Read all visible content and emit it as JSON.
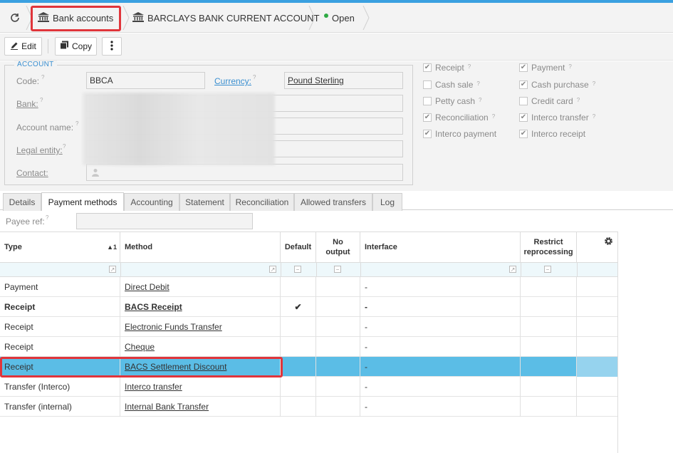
{
  "breadcrumb": {
    "bank_accounts": "Bank accounts",
    "account_name": "BARCLAYS BANK CURRENT ACCOUNT",
    "status": "Open",
    "status_color": "#2eaa44"
  },
  "toolbar": {
    "edit": "Edit",
    "copy": "Copy"
  },
  "account": {
    "legend": "ACCOUNT",
    "code_label": "Code:",
    "code_value": "BBCA",
    "currency_label": "Currency:",
    "currency_value": "Pound Sterling",
    "bank_label": "Bank:",
    "account_name_label": "Account name:",
    "legal_entity_label": "Legal entity:",
    "contact_label": "Contact:"
  },
  "flags": [
    {
      "label": "Receipt",
      "checked": true
    },
    {
      "label": "Payment",
      "checked": true
    },
    {
      "label": "Cash sale",
      "checked": false
    },
    {
      "label": "Cash purchase",
      "checked": true
    },
    {
      "label": "Petty cash",
      "checked": false
    },
    {
      "label": "Credit card",
      "checked": false
    },
    {
      "label": "Reconciliation",
      "checked": true
    },
    {
      "label": "Interco transfer",
      "checked": true
    },
    {
      "label": "Interco payment",
      "checked": true
    },
    {
      "label": "Interco receipt",
      "checked": true
    }
  ],
  "tabs": [
    "Details",
    "Payment methods",
    "Accounting",
    "Statement",
    "Reconciliation",
    "Allowed transfers",
    "Log"
  ],
  "active_tab": "Payment methods",
  "payee_ref_label": "Payee ref:",
  "grid": {
    "columns": {
      "type": "Type",
      "sort": "▲1",
      "method": "Method",
      "default": "Default",
      "no_output_1": "No",
      "no_output_2": "output",
      "interface": "Interface",
      "restrict_1": "Restrict",
      "restrict_2": "reprocessing"
    },
    "rows": [
      {
        "type": "Payment",
        "method": "Direct Debit",
        "default": "",
        "interface": "-",
        "bold": false,
        "selected": false
      },
      {
        "type": "Receipt",
        "method": "BACS Receipt",
        "default": "✔",
        "interface": "-",
        "bold": true,
        "selected": false
      },
      {
        "type": "Receipt",
        "method": "Electronic Funds Transfer",
        "default": "",
        "interface": "-",
        "bold": false,
        "selected": false
      },
      {
        "type": "Receipt",
        "method": "Cheque",
        "default": "",
        "interface": "-",
        "bold": false,
        "selected": false
      },
      {
        "type": "Receipt",
        "method": "BACS Settlement Discount",
        "default": "",
        "interface": "-",
        "bold": false,
        "selected": true
      },
      {
        "type": "Transfer (Interco)",
        "method": "Interco transfer",
        "default": "",
        "interface": "-",
        "bold": false,
        "selected": false
      },
      {
        "type": "Transfer (internal)",
        "method": "Internal Bank Transfer",
        "default": "",
        "interface": "-",
        "bold": false,
        "selected": false
      }
    ]
  },
  "colors": {
    "accent": "#3a8fd0",
    "selected_row": "#5bbde6",
    "highlight": "#e0353b"
  }
}
